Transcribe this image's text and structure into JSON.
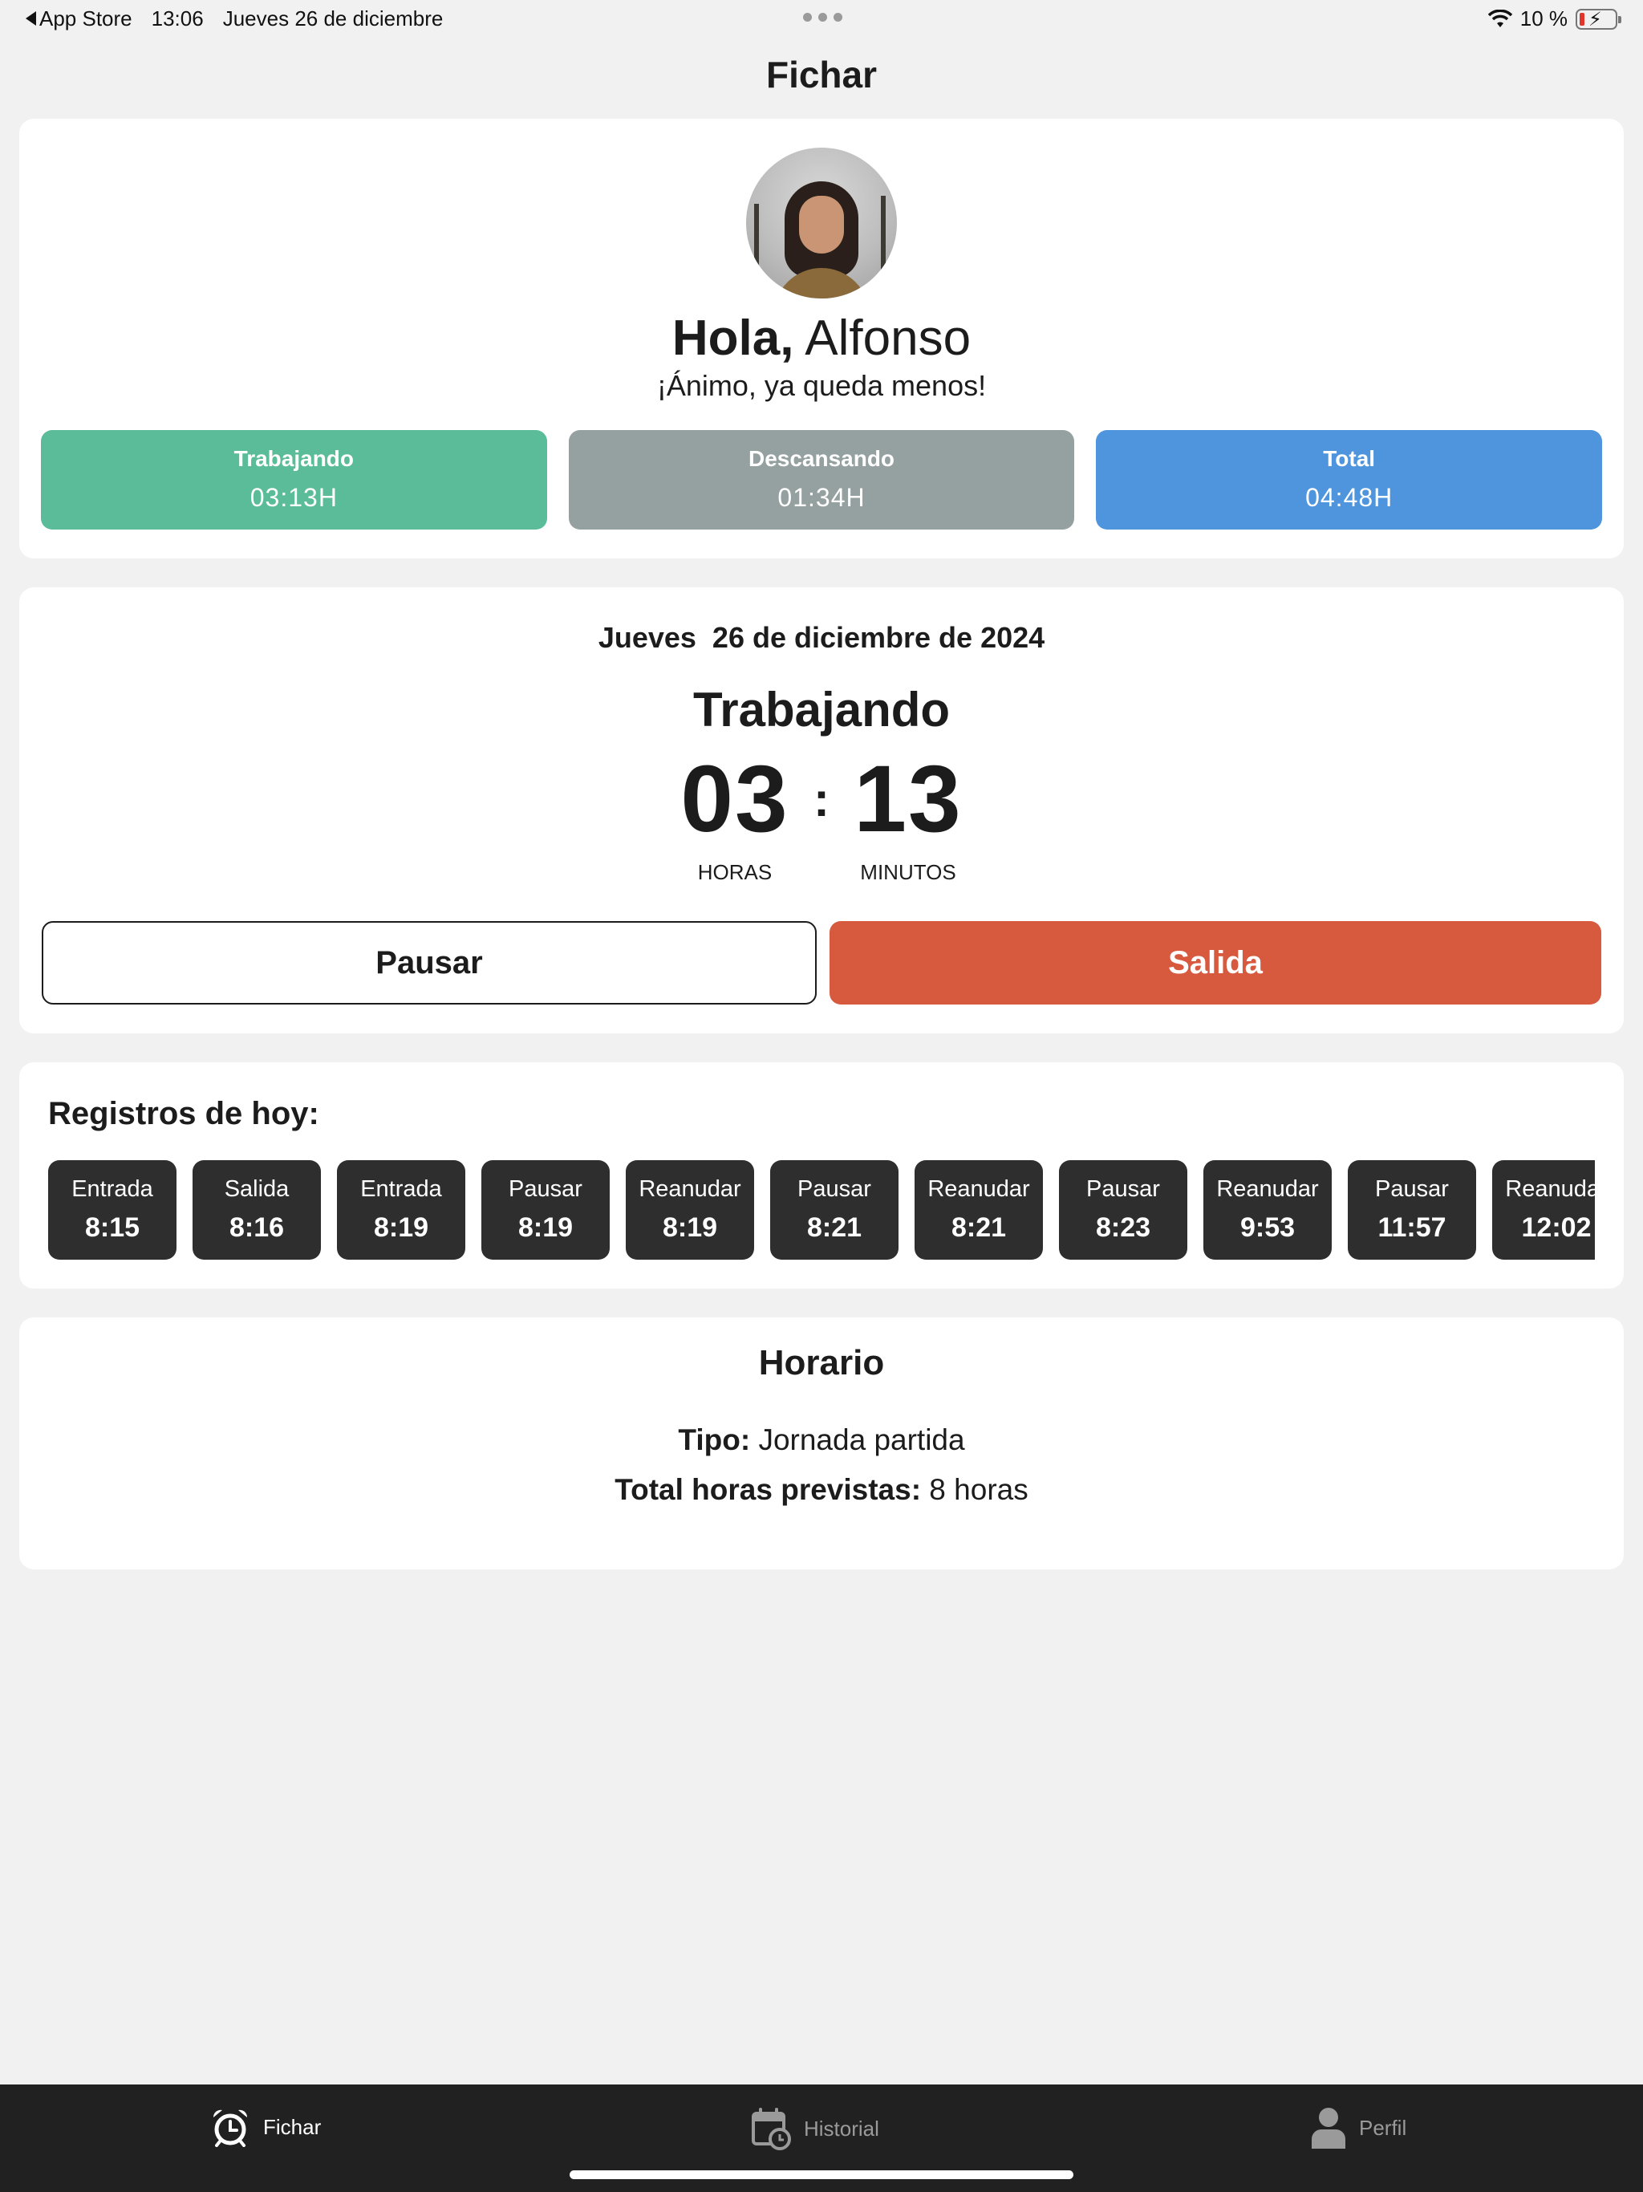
{
  "status_bar": {
    "back_app": "App Store",
    "time": "13:06",
    "date": "Jueves 26 de diciembre",
    "battery": "10 %",
    "battery_level_percent": 10
  },
  "nav": {
    "title": "Fichar"
  },
  "profile": {
    "greeting_bold": "Hola,",
    "name": " Alfonso",
    "message": "¡Ánimo, ya queda menos!",
    "stats": [
      {
        "label": "Trabajando",
        "value": "03:13H",
        "color": "#5bbc99"
      },
      {
        "label": "Descansando",
        "value": "01:34H",
        "color": "#95a0a1"
      },
      {
        "label": "Total",
        "value": "04:48H",
        "color": "#4e95dd"
      }
    ]
  },
  "clock": {
    "date": "Jueves  26 de diciembre de 2024",
    "state": "Trabajando",
    "hours": "03",
    "minutes": "13",
    "separator": ":",
    "hours_label": "HORAS",
    "minutes_label": "MINUTOS",
    "pause_label": "Pausar",
    "exit_label": "Salida",
    "exit_color": "#d75a3e"
  },
  "records": {
    "title": "Registros de hoy:",
    "items": [
      {
        "kind": "Entrada",
        "time": "8:15"
      },
      {
        "kind": "Salida",
        "time": "8:16"
      },
      {
        "kind": "Entrada",
        "time": "8:19"
      },
      {
        "kind": "Pausar",
        "time": "8:19"
      },
      {
        "kind": "Reanudar",
        "time": "8:19"
      },
      {
        "kind": "Pausar",
        "time": "8:21"
      },
      {
        "kind": "Reanudar",
        "time": "8:21"
      },
      {
        "kind": "Pausar",
        "time": "8:23"
      },
      {
        "kind": "Reanudar",
        "time": "9:53"
      },
      {
        "kind": "Pausar",
        "time": "11:57"
      },
      {
        "kind": "Reanudar",
        "time": "12:02"
      }
    ]
  },
  "schedule": {
    "title": "Horario",
    "type_label": "Tipo:",
    "type_value": " Jornada partida",
    "hours_label": "Total horas previstas:",
    "hours_value": " 8 horas"
  },
  "tab_bar": {
    "tabs": [
      {
        "label": "Fichar",
        "icon": "alarm-clock-icon",
        "active": true
      },
      {
        "label": "Historial",
        "icon": "calendar-clock-icon",
        "active": false
      },
      {
        "label": "Perfil",
        "icon": "user-icon",
        "active": false
      }
    ]
  }
}
